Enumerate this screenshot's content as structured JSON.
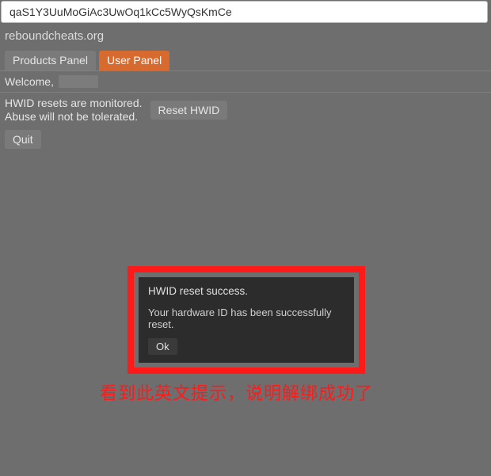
{
  "address_bar": {
    "text": "qaS1Y3UuMoGiAc3UwOq1kCc5WyQsKmCe"
  },
  "header": {
    "site": "reboundcheats.org"
  },
  "tabs": {
    "items": [
      {
        "label": "Products Panel",
        "active": false
      },
      {
        "label": "User Panel",
        "active": true
      }
    ]
  },
  "welcome": {
    "prefix": "Welcome,"
  },
  "hwid": {
    "line1": "HWID resets are monitored.",
    "line2": "Abuse will not be tolerated.",
    "reset_label": "Reset HWID"
  },
  "quit": {
    "label": "Quit"
  },
  "dialog": {
    "title": "HWID reset success.",
    "body": "Your hardware ID has been successfully reset.",
    "ok_label": "Ok"
  },
  "caption": {
    "text": "看到此英文提示，说明解绑成功了"
  },
  "colors": {
    "accent": "#d66a2f",
    "annotation": "#ff1a1a",
    "dialog_bg": "#2c2c2c"
  }
}
